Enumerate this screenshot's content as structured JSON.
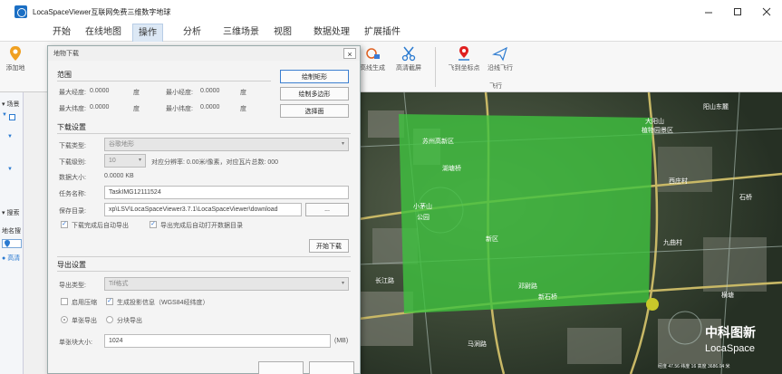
{
  "window": {
    "title": "LocaSpaceViewer互联网免费三维数字地球",
    "min_icon": "minimize-icon",
    "max_icon": "maximize-icon",
    "close_icon": "close-icon"
  },
  "menu": {
    "items": [
      "开始",
      "在线地图",
      "操作",
      "分析",
      "三维场景",
      "视图",
      "数据处理",
      "扩展插件"
    ],
    "active_index": 2
  },
  "ribbon": {
    "left_label": "添加地",
    "tools": [
      "高线生成",
      "高清截屏",
      "飞到坐标点",
      "沿线飞行"
    ],
    "group_label": "飞行"
  },
  "left_panel": {
    "scene_label": "场景",
    "search_label": "搜索",
    "place_label": "地名搜",
    "result_label": "高清"
  },
  "dialog": {
    "title": "地物下载",
    "close_label": "×",
    "range": {
      "title": "范围",
      "max_lon_label": "最大经度:",
      "max_lon_value": "0.0000",
      "min_lon_label": "最小经度:",
      "min_lon_value": "0.0000",
      "max_lat_label": "最大纬度:",
      "max_lat_value": "0.0000",
      "min_lat_label": "最小纬度:",
      "min_lat_value": "0.0000",
      "unit": "度",
      "btn_draw_rect": "绘制矩形",
      "btn_draw_polygon": "绘制多边形",
      "btn_select_face": "选择面"
    },
    "download": {
      "title": "下载设置",
      "type_label": "下载类型:",
      "type_value": "谷歌地形",
      "level_label": "下载级别:",
      "level_value": "10",
      "level_info": "对应分辨率: 0.00米/像素，对应瓦片总数: 000",
      "size_label": "数据大小:",
      "size_value": "0.0000 KB",
      "task_label": "任务名称:",
      "task_value": "TaskIMG12111524",
      "dir_label": "保存目录:",
      "dir_value": "xp\\LSV\\LocaSpaceViewer3.7.1\\LocaSpaceViewer\\download",
      "dir_btn": "...",
      "check_auto_export": "下载完成后自动导出",
      "check_open_dir": "导出完成后自动打开数据目录",
      "btn_start": "开始下载"
    },
    "export": {
      "title": "导出设置",
      "type_label": "导出类型:",
      "type_value": "Tif格式",
      "check_compress": "启用压缩",
      "check_projection": "生成投影信息（WGS84经纬度）",
      "radio_single": "单张导出",
      "radio_tiles": "分块导出",
      "max_size_label": "单张块大小:",
      "max_size_value": "1024",
      "max_size_unit": "(MB)"
    }
  },
  "map": {
    "watermark_cn": "中科图新",
    "watermark_en": "LocaSpace",
    "status": "经度 47.56 纬度 16 高度 3686.04 米",
    "labels": [
      "大阳山",
      "植物园景区",
      "阳山东麓",
      "西庄村",
      "九曲村",
      "新石桥",
      "苏州高新区",
      "小茅山",
      "公园",
      "湖塘桥",
      "长江路",
      "马涧路",
      "新区",
      "邓尉路",
      "石桥",
      "横塘"
    ],
    "colors": {
      "selection": "#3fc23f",
      "road": "#c8b866",
      "marker": "#c8c82a"
    }
  }
}
